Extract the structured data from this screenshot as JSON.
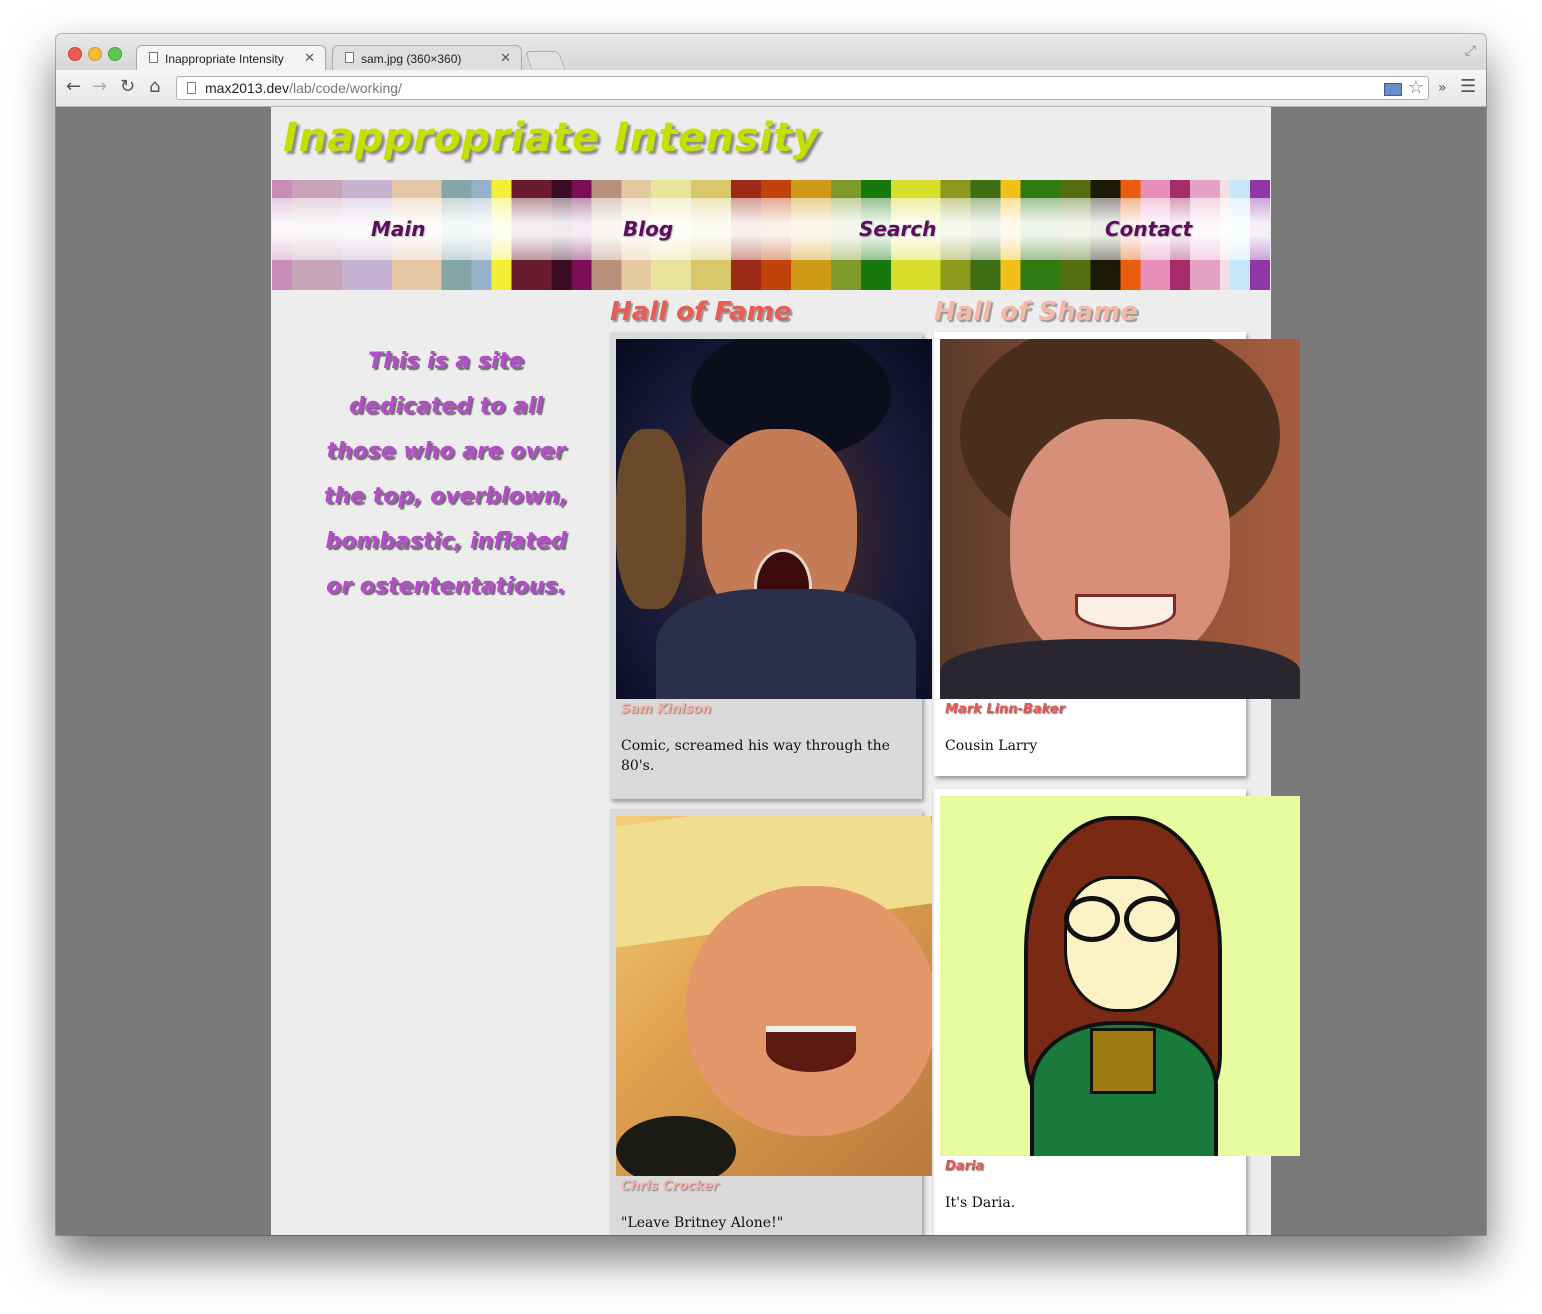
{
  "browser": {
    "tabs": [
      {
        "label": "Inappropriate Intensity",
        "active": true
      },
      {
        "label": "sam.jpg (360×360)",
        "active": false
      }
    ],
    "address_host": "max2013.dev",
    "address_path": "/lab/code/working/",
    "toolbar_icons": [
      "back-icon",
      "forward-icon",
      "reload-icon",
      "home-icon",
      "html5-icon",
      "star-icon",
      "overflow-icon",
      "menu-icon"
    ]
  },
  "site": {
    "title": "Inappropriate Intensity",
    "nav": [
      "Main",
      "Blog",
      "Search",
      "Contact"
    ],
    "intro": "This is a site dedicated to all those who are over the top, overblown, bombastic, inflated or ostententatious."
  },
  "hall_of_fame": {
    "heading": "Hall of Fame",
    "cards": [
      {
        "name": "Sam Kinison",
        "desc": "Comic, screamed his way through the 80's."
      },
      {
        "name": "Chris Crocker",
        "desc": "\"Leave Britney Alone!\""
      }
    ]
  },
  "hall_of_shame": {
    "heading": "Hall of Shame",
    "cards": [
      {
        "name": "Mark Linn-Baker",
        "desc": "Cousin Larry"
      },
      {
        "name": "Daria",
        "desc": "It's Daria."
      }
    ]
  },
  "colors": {
    "title": "#c5e000",
    "nav_text": "#5e0c5e",
    "intro_text": "#b54dcb",
    "fame_heading": "#ea5b54",
    "shame_heading": "#f4b8a8",
    "page_bg": "#ededed",
    "viewport_bg": "#7a7a7a"
  }
}
